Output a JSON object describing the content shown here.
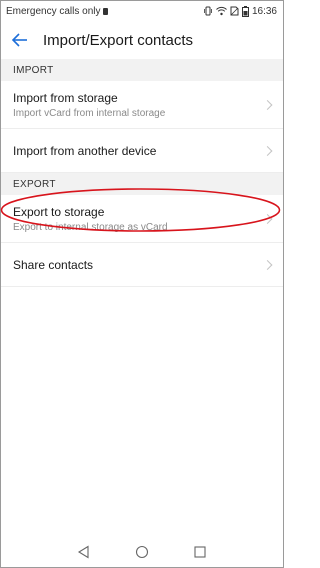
{
  "status_bar": {
    "carrier_text": "Emergency calls only",
    "time": "16:36",
    "icons": [
      "vibrate-icon",
      "wifi-icon",
      "no-sim-icon",
      "battery-icon"
    ]
  },
  "app_bar": {
    "title": "Import/Export contacts",
    "back_icon": "arrow-left-icon"
  },
  "import_section": {
    "header": "IMPORT",
    "items": [
      {
        "primary": "Import from storage",
        "secondary": "Import vCard from internal storage"
      },
      {
        "primary": "Import from another device",
        "secondary": ""
      }
    ]
  },
  "export_section": {
    "header": "EXPORT",
    "items": [
      {
        "primary": "Export to storage",
        "secondary": "Export to internal storage as vCard"
      },
      {
        "primary": "Share contacts",
        "secondary": ""
      }
    ]
  },
  "annotation": {
    "color": "#d8141c",
    "shape": "ellipse",
    "target": "Export to storage"
  },
  "nav_bar": {
    "icons": [
      "back-triangle-icon",
      "home-circle-icon",
      "recents-square-icon"
    ]
  },
  "colors": {
    "accent": "#1e6fd9",
    "section_bg": "#f2f2f2",
    "annotation": "#d8141c"
  }
}
